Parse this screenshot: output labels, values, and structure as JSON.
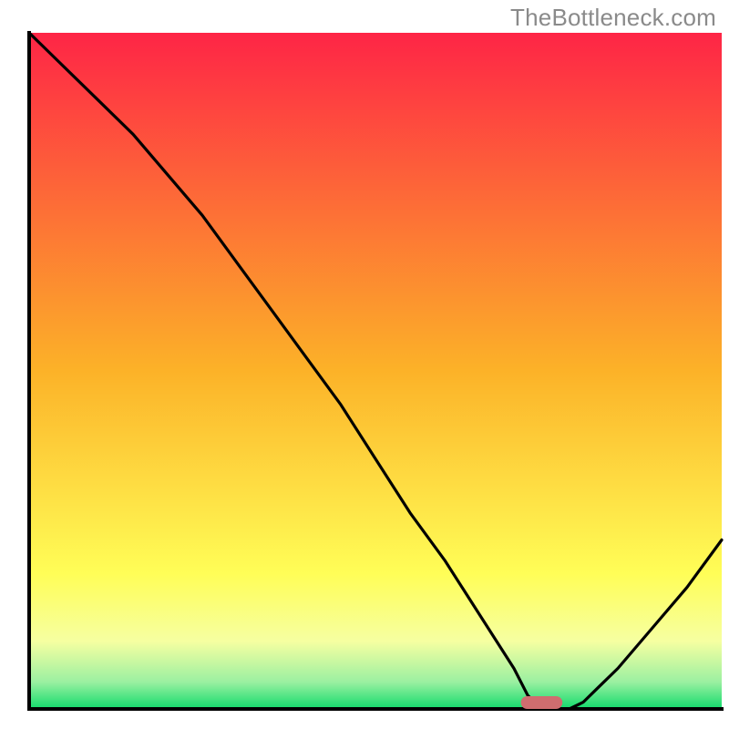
{
  "watermark": {
    "text": "TheBottleneck.com"
  },
  "chart_data": {
    "type": "line",
    "title": "",
    "xlabel": "",
    "ylabel": "",
    "xlim": [
      0,
      100
    ],
    "ylim": [
      0,
      100
    ],
    "grid": false,
    "legend": false,
    "series": [
      {
        "name": "bottleneck-curve",
        "x": [
          0,
          5,
          10,
          15,
          20,
          25,
          30,
          35,
          40,
          45,
          50,
          55,
          60,
          65,
          70,
          72,
          74,
          76,
          78,
          80,
          82,
          85,
          90,
          95,
          100
        ],
        "y": [
          100,
          95,
          90,
          85,
          79,
          73,
          66,
          59,
          52,
          45,
          37,
          29,
          22,
          14,
          6,
          2,
          0,
          0,
          0,
          1,
          3,
          6,
          12,
          18,
          25
        ]
      }
    ],
    "marker": {
      "name": "optimal-point",
      "x": 74,
      "y": 0,
      "width_x": 6,
      "color": "#cf6d6f"
    },
    "background_gradient": {
      "stops": [
        {
          "offset": 0.0,
          "color": "#fe2546"
        },
        {
          "offset": 0.5,
          "color": "#fcb228"
        },
        {
          "offset": 0.8,
          "color": "#fffe57"
        },
        {
          "offset": 0.9,
          "color": "#f6ffa1"
        },
        {
          "offset": 0.96,
          "color": "#9bf0a1"
        },
        {
          "offset": 1.0,
          "color": "#12db6c"
        }
      ]
    },
    "axes": {
      "color": "#000000",
      "width": 4
    }
  }
}
